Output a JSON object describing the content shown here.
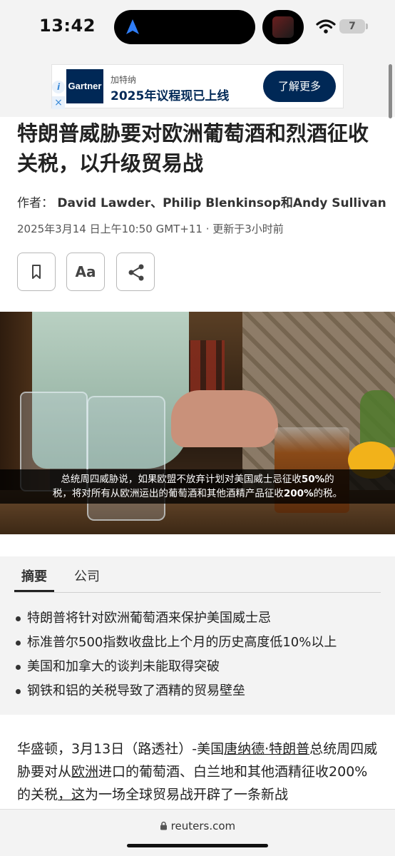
{
  "status_bar": {
    "time": "13:42",
    "battery": "7"
  },
  "ad": {
    "logo_text": "Gartner",
    "brand": "加特纳",
    "headline": "2025年议程现已上线",
    "cta": "了解更多"
  },
  "article": {
    "headline": "特朗普威胁要对欧洲葡萄酒和烈酒征收关税，以升级贸易战",
    "byline_prefix": "作者：",
    "authors": "David Lawder、Philip Blenkinsop和Andy Sullivan",
    "dateline": "2025年3月14 日上午10:50 GMT+11 · 更新于3小时前",
    "tools": {
      "font_label": "Aa"
    }
  },
  "photo": {
    "caption_line1_a": "总统周四威胁说，如果欧盟不放弃计划对美国威士忌征收",
    "caption_line1_b": "50%",
    "caption_line1_c": "的",
    "caption_line2_a": "税，将对所有从欧洲运出的葡萄酒和其他酒精产品征收",
    "caption_line2_b": "200%",
    "caption_line2_c": "的税。"
  },
  "summary": {
    "tabs": [
      "摘要",
      "公司"
    ],
    "bullets": [
      "特朗普将针对欧洲葡萄酒来保护美国威士忌",
      "标准普尔500指数收盘比上个月的历史高度低10%以上",
      "美国和加拿大的谈判未能取得突破",
      "钢铁和铝的关税导致了酒精的贸易壁垒"
    ]
  },
  "body": {
    "p1_a": "华盛顿，3月13日（路透社）-美国",
    "p1_link1": "唐纳德·特朗普",
    "p1_b": "总统周四威胁要对从",
    "p1_link2": "欧洲",
    "p1_c": "进口的葡萄酒、白兰地和其他酒精征收200%的关税",
    "p1_link3": "，这",
    "p1_d": "为一场全球贸易战开辟了一条新战"
  },
  "browser": {
    "url": "reuters.com"
  },
  "colors": {
    "gartner_navy": "#002856",
    "caption_bg": "#000000"
  }
}
